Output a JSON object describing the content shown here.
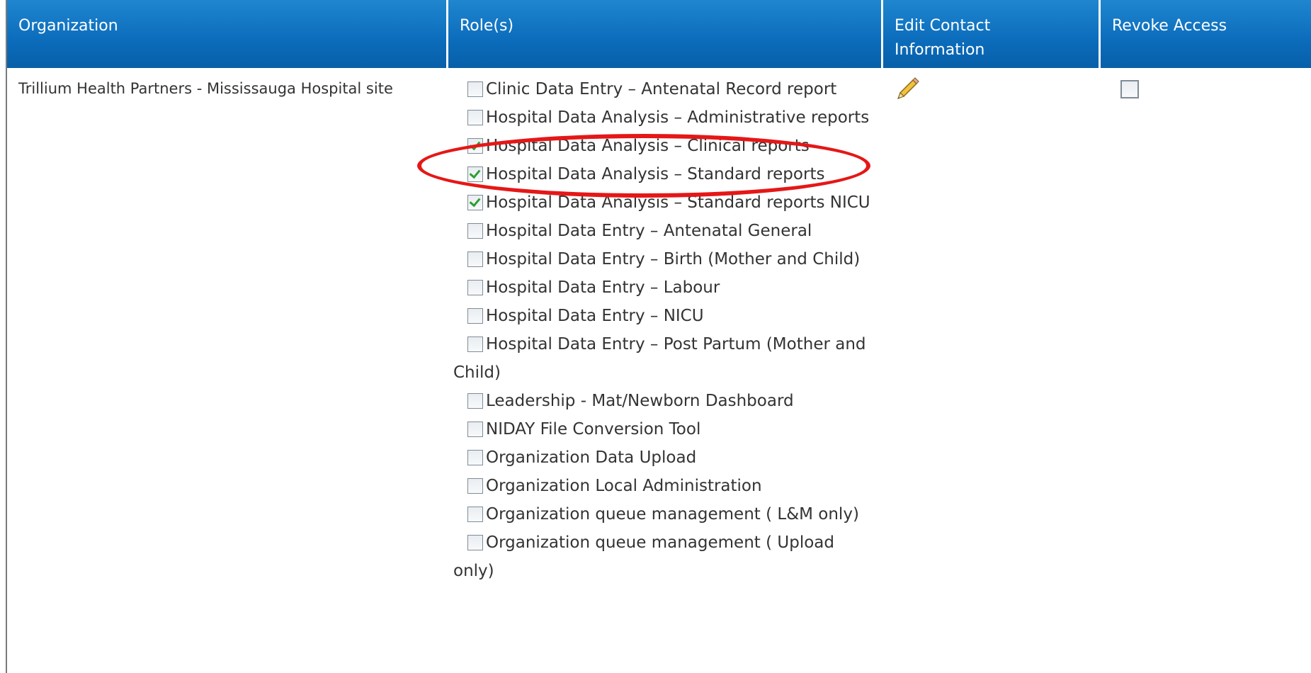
{
  "table": {
    "headers": {
      "organization": "Organization",
      "roles": "Role(s)",
      "edit_contact": "Edit Contact Information",
      "revoke": "Revoke Access"
    },
    "row": {
      "organization": "Trillium Health Partners - Mississauga Hospital site",
      "roles": [
        {
          "label": "Clinic Data Entry – Antenatal Record report",
          "checked": false
        },
        {
          "label": "Hospital Data Analysis – Administrative reports",
          "checked": false
        },
        {
          "label": "Hospital Data Analysis – Clinical reports",
          "checked": true
        },
        {
          "label": "Hospital Data Analysis – Standard reports",
          "checked": true
        },
        {
          "label": "Hospital Data Analysis – Standard reports NICU",
          "checked": true
        },
        {
          "label": "Hospital Data Entry – Antenatal General",
          "checked": false
        },
        {
          "label": "Hospital Data Entry – Birth (Mother and Child)",
          "checked": false
        },
        {
          "label": "Hospital Data Entry – Labour",
          "checked": false
        },
        {
          "label": "Hospital Data Entry – NICU",
          "checked": false
        },
        {
          "label": "Hospital Data Entry – Post Partum (Mother and Child)",
          "checked": false
        },
        {
          "label": "Leadership - Mat/Newborn Dashboard",
          "checked": false
        },
        {
          "label": "NIDAY File Conversion Tool",
          "checked": false
        },
        {
          "label": "Organization Data Upload",
          "checked": false
        },
        {
          "label": "Organization Local Administration",
          "checked": false
        },
        {
          "label": "Organization queue management ( L&M only)",
          "checked": false
        },
        {
          "label": "Organization queue management ( Upload only)",
          "checked": false
        }
      ],
      "edit_icon": "pencil-icon",
      "revoke_checked": false
    }
  },
  "colors": {
    "header_bg": "#0b6cbb",
    "highlight_ellipse": "#e51717",
    "check": "#2e9e34"
  }
}
